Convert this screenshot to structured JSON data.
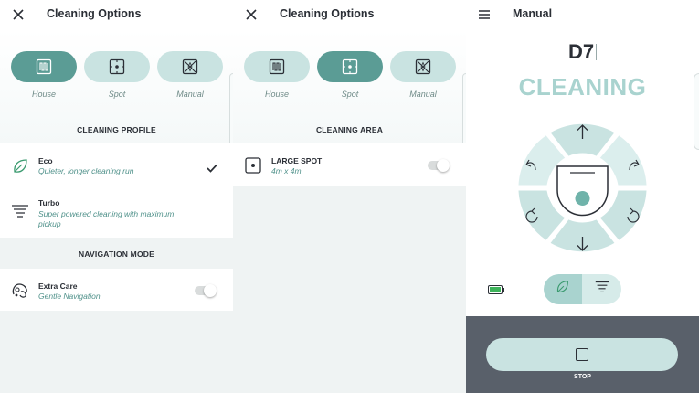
{
  "panels": {
    "profile": {
      "title": "Cleaning Options",
      "modes": [
        {
          "label": "House",
          "icon": "house-zigzag-icon",
          "active": true
        },
        {
          "label": "Spot",
          "icon": "spot-icon",
          "active": false
        },
        {
          "label": "Manual",
          "icon": "manual-cross-icon",
          "active": false
        }
      ],
      "profile_heading": "CLEANING PROFILE",
      "profiles": [
        {
          "title": "Eco",
          "subtitle": "Quieter, longer cleaning run",
          "icon": "leaf-icon",
          "selected": true
        },
        {
          "title": "Turbo",
          "subtitle": "Super powered cleaning with maximum pickup",
          "icon": "turbo-lines-icon",
          "selected": false
        }
      ],
      "navigation_heading": "NAVIGATION MODE",
      "navigation": {
        "title": "Extra Care",
        "subtitle": "Gentle Navigation",
        "icon": "robot-paw-icon",
        "enabled": false
      }
    },
    "area": {
      "title": "Cleaning Options",
      "modes": [
        {
          "label": "House",
          "icon": "house-zigzag-icon",
          "active": false
        },
        {
          "label": "Spot",
          "icon": "spot-icon",
          "active": true
        },
        {
          "label": "Manual",
          "icon": "manual-cross-icon",
          "active": false
        }
      ],
      "area_heading": "CLEANING AREA",
      "area": {
        "title": "LARGE SPOT",
        "subtitle": "4m x 4m",
        "icon": "spot-icon",
        "enabled": false
      }
    },
    "manual": {
      "title": "Manual",
      "robot_name": "D7",
      "status": "CLEANING",
      "controls": [
        "forward",
        "rotate-left",
        "rotate-right",
        "turn-left",
        "turn-right",
        "backward"
      ],
      "battery": "full",
      "power_mode": "eco",
      "stop_label": "STOP"
    }
  },
  "colors": {
    "accent": "#5b9c95",
    "accent_light": "#c9e3e1",
    "status_text": "#a9d3cf",
    "subtitle": "#4f918a",
    "footer": "#59606a"
  }
}
